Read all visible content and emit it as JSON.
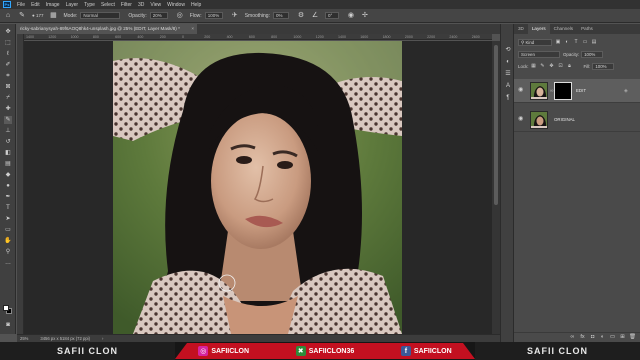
{
  "menubar": {
    "logo": "Ps",
    "items": [
      "File",
      "Edit",
      "Image",
      "Layer",
      "Type",
      "Select",
      "Filter",
      "3D",
      "View",
      "Window",
      "Help"
    ]
  },
  "options": {
    "brush_size": "177",
    "mode_label": "Mode:",
    "mode_value": "Normal",
    "opacity_label": "Opacity:",
    "opacity_value": "20%",
    "flow_label": "Flow:",
    "flow_value": "100%",
    "smoothing_label": "Smoothing:",
    "smoothing_value": "0%",
    "angle_value": "0°"
  },
  "document": {
    "tab_title": "ricky-sabrianysyah-89f6AOQ8hk4-unsplash.jpg @ 25% (EDIT, Layer Mask/8) *"
  },
  "rulers": {
    "top": [
      "1400",
      "1200",
      "1000",
      "800",
      "600",
      "400",
      "200",
      "0",
      "200",
      "400",
      "600",
      "800",
      "1000",
      "1200",
      "1400",
      "1600",
      "1800",
      "2000",
      "2200",
      "2400",
      "2600"
    ]
  },
  "status": {
    "zoom": "25%",
    "size": "3456 px x 5184 px (72 ppi)"
  },
  "layers_panel": {
    "tabs": [
      "3D",
      "Layers",
      "Channels",
      "Paths"
    ],
    "kind_label": "Kind",
    "blend_mode": "Screen",
    "opacity_label": "Opacity:",
    "opacity_value": "100%",
    "lock_label": "Lock:",
    "fill_label": "Fill:",
    "fill_value": "100%",
    "layers": [
      {
        "name": "EDIT",
        "has_mask": true
      },
      {
        "name": "ORIGINAL",
        "has_mask": false
      }
    ]
  },
  "banner": {
    "left": "SAFII CLON",
    "instagram": "SAFIICLON",
    "other": "SAFIICLON36",
    "facebook": "SAFIICLON",
    "right": "SAFII CLON"
  },
  "colors": {
    "instagram": "#d6249f",
    "other": "#2e8b3a",
    "facebook": "#3b5998",
    "banner_red": "#c31020",
    "foreground": "#ffffff",
    "background": "#000000"
  }
}
